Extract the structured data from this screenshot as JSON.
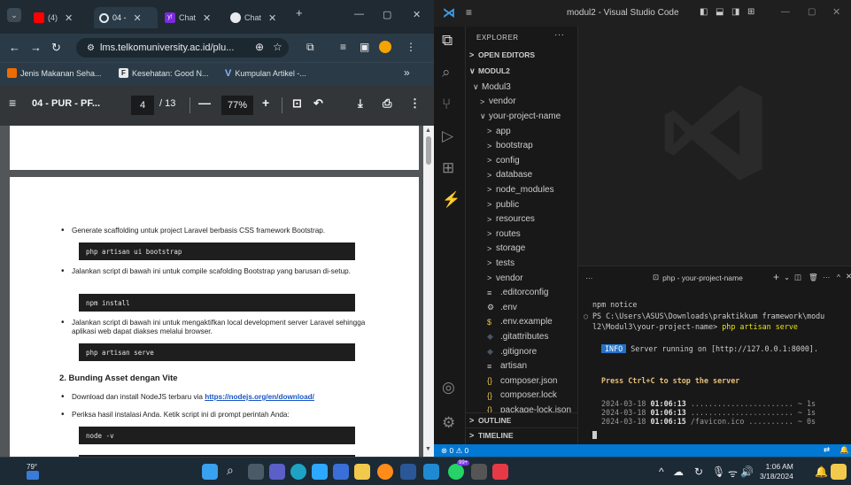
{
  "browser": {
    "tabs": [
      {
        "label": "(4)",
        "active": false
      },
      {
        "label": "04 -",
        "active": true
      },
      {
        "label": "Chat",
        "active": false
      },
      {
        "label": "Chat",
        "active": false
      }
    ],
    "url": "lms.telkomuniversity.ac.id/plu...",
    "bookmarks": [
      {
        "label": "Jenis Makanan Seha..."
      },
      {
        "label": "Kesehatan: Good N..."
      },
      {
        "label": "Kumpulan Artikel -..."
      }
    ],
    "bookmarks_more": "»",
    "pdf": {
      "title": "04 - PUR - PF...",
      "page_current": "4",
      "page_total": "/ 13",
      "zoom": "77%"
    },
    "doc": {
      "b1": "Generate scaffolding untuk project Laravel berbasis CSS framework Bootstrap.",
      "c1": "php artisan ui bootstrap",
      "b2": "Jalankan script di bawah ini untuk compile scafolding Bootstrap yang barusan di-setup.",
      "c2": "npm install",
      "b3": "Jalankan script di bawah ini untuk mengaktifkan local development server Laravel sehingga aplikasi web dapat diakses melalui browser.",
      "c3": "php artisan serve",
      "h2": "2. Bunding Asset dengan Vite",
      "b4_text": "Download dan install NodeJS terbaru via ",
      "b4_link": "https://nodejs.org/en/download/",
      "b5": "Periksa hasil instalasi Anda. Ketik script ini di prompt perintah Anda:",
      "c4": "node -v"
    }
  },
  "vscode": {
    "title": "modul2 - Visual Studio Code",
    "explorer_label": "EXPLORER",
    "explorer_more": "···",
    "open_editors": "OPEN EDITORS",
    "workspace": "MODUL2",
    "tree": [
      {
        "label": "Modul3",
        "indent": 1,
        "chev": "∨"
      },
      {
        "label": "vendor",
        "indent": 2,
        "chev": ">"
      },
      {
        "label": "your-project-name",
        "indent": 2,
        "chev": "∨"
      },
      {
        "label": "app",
        "indent": 3,
        "chev": ">"
      },
      {
        "label": "bootstrap",
        "indent": 3,
        "chev": ">"
      },
      {
        "label": "config",
        "indent": 3,
        "chev": ">"
      },
      {
        "label": "database",
        "indent": 3,
        "chev": ">"
      },
      {
        "label": "node_modules",
        "indent": 3,
        "chev": ">"
      },
      {
        "label": "public",
        "indent": 3,
        "chev": ">"
      },
      {
        "label": "resources",
        "indent": 3,
        "chev": ">"
      },
      {
        "label": "routes",
        "indent": 3,
        "chev": ">"
      },
      {
        "label": "storage",
        "indent": 3,
        "chev": ">"
      },
      {
        "label": "tests",
        "indent": 3,
        "chev": ">"
      },
      {
        "label": "vendor",
        "indent": 3,
        "chev": ">"
      },
      {
        "label": ".editorconfig",
        "indent": 3,
        "icon": "≡",
        "icon_color": "#cccccc"
      },
      {
        "label": ".env",
        "indent": 3,
        "icon": "⚙",
        "icon_color": "#cccccc"
      },
      {
        "label": ".env.example",
        "indent": 3,
        "icon": "$",
        "icon_color": "#e8c547"
      },
      {
        "label": ".gitattributes",
        "indent": 3,
        "icon": "◆",
        "icon_color": "#4a5563"
      },
      {
        "label": ".gitignore",
        "indent": 3,
        "icon": "◆",
        "icon_color": "#4a5563"
      },
      {
        "label": "artisan",
        "indent": 3,
        "icon": "≡",
        "icon_color": "#cccccc"
      },
      {
        "label": "composer.json",
        "indent": 3,
        "icon": "{}",
        "icon_color": "#e8c547"
      },
      {
        "label": "composer.lock",
        "indent": 3,
        "icon": "{}",
        "icon_color": "#e8c547"
      },
      {
        "label": "package-lock.json",
        "indent": 3,
        "icon": "{}",
        "icon_color": "#e8c547"
      }
    ],
    "outline": "OUTLINE",
    "timeline": "TIMELINE",
    "terminal": {
      "dots": "···",
      "name": "php - your-project-name",
      "lines": [
        {
          "t": "npm notice",
          "kind": "notice"
        },
        {
          "t": "PS C:\\Users\\ASUS\\Downloads\\praktikkum framework\\modu",
          "kind": "ps"
        },
        {
          "t": "l2\\Modul3\\your-project-name> ",
          "cmd": "php artisan serve",
          "kind": "ps2"
        },
        {
          "t": "",
          "kind": "blank"
        },
        {
          "t": "INFO",
          "rest": " Server running on [http://127.0.0.1:8000].",
          "kind": "info"
        },
        {
          "t": "",
          "kind": "blank"
        },
        {
          "t": "Press Ctrl+C to stop the server",
          "kind": "yellow"
        },
        {
          "t": "",
          "kind": "blank"
        },
        {
          "t": "2024-03-18 ",
          "b": "01:06:13",
          "rest": " ....................... ~ 1s",
          "kind": "log"
        },
        {
          "t": "2024-03-18 ",
          "b": "01:06:13",
          "rest": " ....................... ~ 1s",
          "kind": "log"
        },
        {
          "t": "2024-03-18 ",
          "b": "01:06:15",
          "rest": " /favicon.ico .......... ~ 0s",
          "kind": "log"
        }
      ]
    },
    "status": {
      "problems": "⊗ 0 ⚠ 0"
    }
  },
  "taskbar": {
    "weather": "79°",
    "badge": "99+",
    "time": "1:06 AM",
    "date": "3/18/2024"
  }
}
